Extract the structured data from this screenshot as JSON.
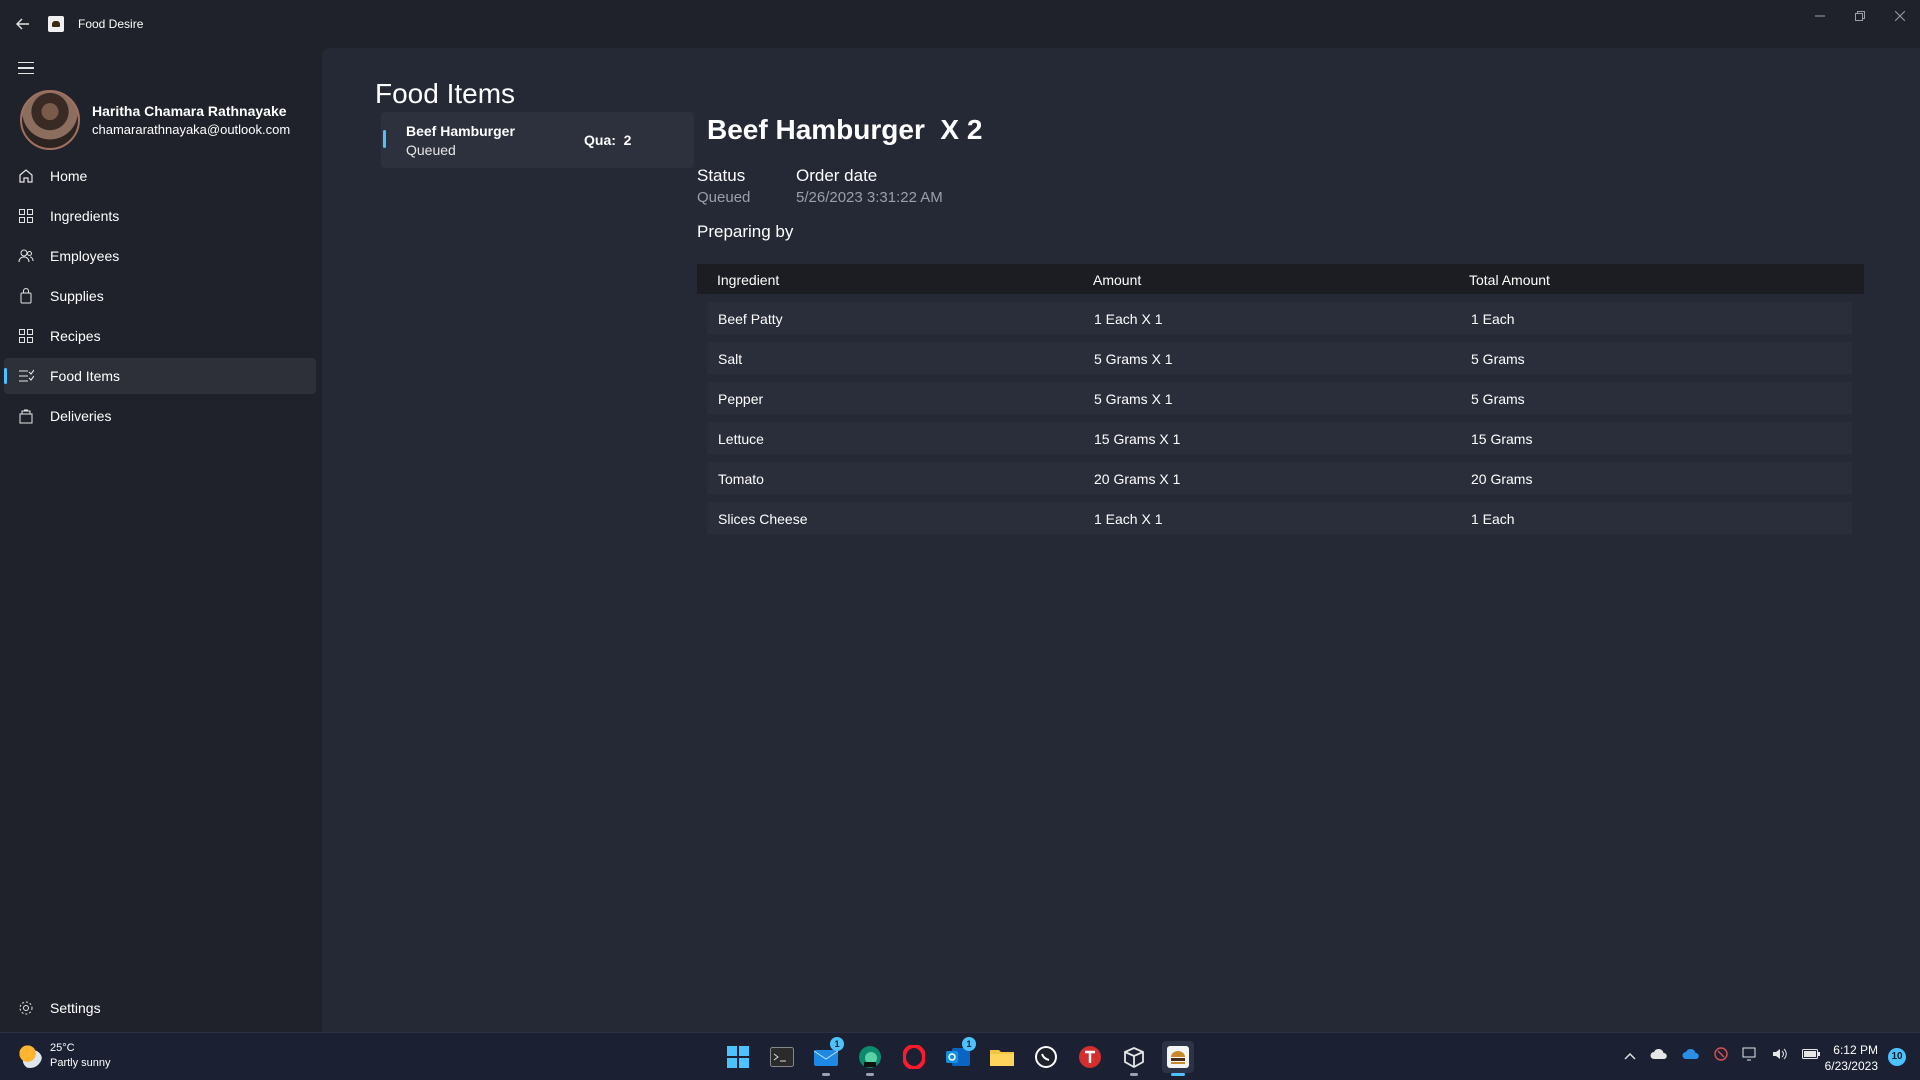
{
  "window": {
    "title": "Food Desire",
    "controls": [
      "minimize",
      "restore",
      "close"
    ]
  },
  "sidebar": {
    "user": {
      "name": "Haritha Chamara Rathnayake",
      "email": "chamararathnayaka@outlook.com"
    },
    "items": [
      {
        "label": "Home",
        "icon": "home-icon"
      },
      {
        "label": "Ingredients",
        "icon": "grid-icon"
      },
      {
        "label": "Employees",
        "icon": "people-icon"
      },
      {
        "label": "Supplies",
        "icon": "bag-icon"
      },
      {
        "label": "Recipes",
        "icon": "grid-icon"
      },
      {
        "label": "Food Items",
        "icon": "list-icon",
        "active": true
      },
      {
        "label": "Deliveries",
        "icon": "delivery-icon"
      }
    ],
    "settings_label": "Settings"
  },
  "page": {
    "title": "Food Items",
    "list": [
      {
        "name": "Beef Hamburger",
        "status": "Queued",
        "qua_label": "Qua:",
        "qua_value": "2"
      }
    ]
  },
  "detail": {
    "title": "Beef Hamburger  X 2",
    "status_label": "Status",
    "status_value": "Queued",
    "order_date_label": "Order date",
    "order_date_value": "5/26/2023 3:31:22 AM",
    "preparing_label": "Preparing by",
    "table": {
      "columns": [
        "Ingredient",
        "Amount",
        "Total Amount"
      ],
      "rows": [
        [
          "Beef Patty",
          "1 Each X 1",
          "1 Each"
        ],
        [
          "Salt",
          "5 Grams X 1",
          "5 Grams"
        ],
        [
          "Pepper",
          "5 Grams X 1",
          "5 Grams"
        ],
        [
          "Lettuce",
          "15 Grams X 1",
          "15 Grams"
        ],
        [
          "Tomato",
          "20 Grams X 1",
          "20 Grams"
        ],
        [
          "Slices Cheese",
          "1 Each X 1",
          "1 Each"
        ]
      ]
    }
  },
  "taskbar": {
    "weather": {
      "temp": "25°C",
      "desc": "Partly sunny"
    },
    "apps": [
      {
        "name": "start-icon"
      },
      {
        "name": "terminal-icon"
      },
      {
        "name": "mail-icon",
        "badge": "1"
      },
      {
        "name": "edge-dev-icon"
      },
      {
        "name": "opera-icon"
      },
      {
        "name": "outlook-icon",
        "badge": "1"
      },
      {
        "name": "file-explorer-icon"
      },
      {
        "name": "whatsapp-icon"
      },
      {
        "name": "t-app-icon"
      },
      {
        "name": "box-app-icon"
      },
      {
        "name": "food-desire-icon",
        "active": true
      }
    ],
    "time": "6:12 PM",
    "date": "6/23/2023",
    "notifications": "10"
  },
  "colors": {
    "accent": "#4cc2ff",
    "background": "#1f222b",
    "content": "#252935",
    "row": "#2a2e3a",
    "header_row": "#1b1d22"
  }
}
